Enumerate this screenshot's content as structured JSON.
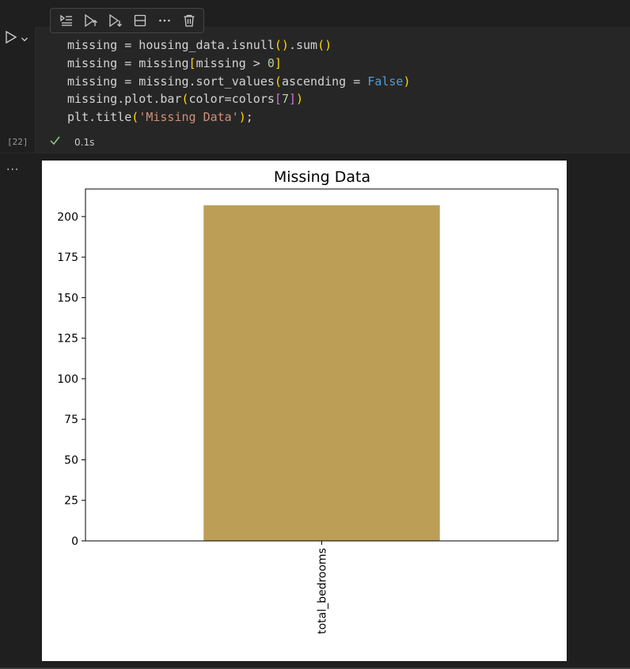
{
  "cell": {
    "execution_count": "[22]",
    "timing": "0.1s",
    "code_lines": [
      [
        {
          "t": "missing = housing_data.isnull",
          "c": "#d4d4d4"
        },
        {
          "t": "()",
          "c": "#ffd700"
        },
        {
          "t": ".sum",
          "c": "#d4d4d4"
        },
        {
          "t": "()",
          "c": "#ffd700"
        }
      ],
      [
        {
          "t": "missing = missing",
          "c": "#d4d4d4"
        },
        {
          "t": "[",
          "c": "#ffd700"
        },
        {
          "t": "missing > ",
          "c": "#d4d4d4"
        },
        {
          "t": "0",
          "c": "#b5cea8"
        },
        {
          "t": "]",
          "c": "#ffd700"
        }
      ],
      [
        {
          "t": "missing = missing.sort_values",
          "c": "#d4d4d4"
        },
        {
          "t": "(",
          "c": "#ffd700"
        },
        {
          "t": "ascending = ",
          "c": "#d4d4d4"
        },
        {
          "t": "False",
          "c": "#569cd6"
        },
        {
          "t": ")",
          "c": "#ffd700"
        }
      ],
      [
        {
          "t": "missing.plot.bar",
          "c": "#d4d4d4"
        },
        {
          "t": "(",
          "c": "#ffd700"
        },
        {
          "t": "color=colors",
          "c": "#d4d4d4"
        },
        {
          "t": "[",
          "c": "#da70d6"
        },
        {
          "t": "7",
          "c": "#b5cea8"
        },
        {
          "t": "]",
          "c": "#da70d6"
        },
        {
          "t": ")",
          "c": "#ffd700"
        }
      ],
      [
        {
          "t": "plt.title",
          "c": "#d4d4d4"
        },
        {
          "t": "(",
          "c": "#ffd700"
        },
        {
          "t": "'Missing Data'",
          "c": "#ce9178"
        },
        {
          "t": ")",
          "c": "#ffd700"
        },
        {
          "t": ";",
          "c": "#d4d4d4"
        }
      ]
    ]
  },
  "toolbar": {
    "icons": [
      "run-by-line-icon",
      "execute-above-icon",
      "execute-below-icon",
      "split-cell-icon",
      "more-actions-icon",
      "delete-cell-icon"
    ]
  },
  "output_menu": "...",
  "colors": {
    "bar": "#bd9e56",
    "check": "#89d185",
    "cell_bg": "#262626",
    "page_bg": "#1f1f1f"
  },
  "chart_data": {
    "type": "bar",
    "title": "Missing Data",
    "categories": [
      "total_bedrooms"
    ],
    "values": [
      207
    ],
    "ylim": [
      0,
      217
    ],
    "yticks": [
      0,
      25,
      50,
      75,
      100,
      125,
      150,
      175,
      200
    ],
    "xlabel": "",
    "ylabel": "",
    "grid": false,
    "bar_color": "#bd9e56"
  }
}
